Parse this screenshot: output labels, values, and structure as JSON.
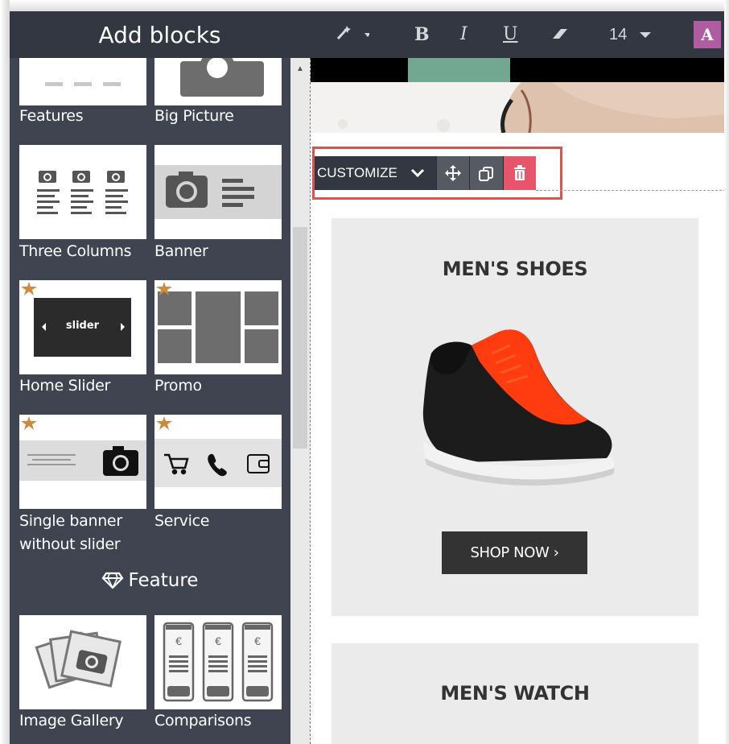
{
  "panel": {
    "title": "Add blocks",
    "tiles": [
      {
        "label": "Features",
        "icon": "features-thumbnail"
      },
      {
        "label": "Big Picture",
        "icon": "big-picture-thumbnail"
      },
      {
        "label": "Three Columns",
        "icon": "three-columns-thumbnail"
      },
      {
        "label": "Banner",
        "icon": "banner-thumbnail"
      },
      {
        "label": "Home Slider",
        "icon": "home-slider-thumbnail",
        "slider_text": "slider"
      },
      {
        "label": "Promo",
        "icon": "promo-thumbnail"
      },
      {
        "label": "Single banner",
        "label2": "without slider",
        "icon": "single-banner-thumbnail"
      },
      {
        "label": "Service",
        "icon": "service-thumbnail"
      },
      {
        "label": "Image Gallery",
        "icon": "image-gallery-thumbnail"
      },
      {
        "label": "Comparisons",
        "icon": "comparisons-thumbnail",
        "currency": "€"
      }
    ],
    "section_feature": "Feature"
  },
  "toolbar": {
    "font_size": "14",
    "bold": "B",
    "italic": "I",
    "underline": "U",
    "text_color_label": "A",
    "accent": "#b05ca0"
  },
  "canvas": {
    "customize_label": "CUSTOMIZE",
    "cards": [
      {
        "title": "MEN'S SHOES",
        "button": "SHOP NOW ›"
      },
      {
        "title": "MEN'S WATCH"
      }
    ],
    "highlight_color": "#d9534f",
    "delete_color": "#e8546a"
  }
}
